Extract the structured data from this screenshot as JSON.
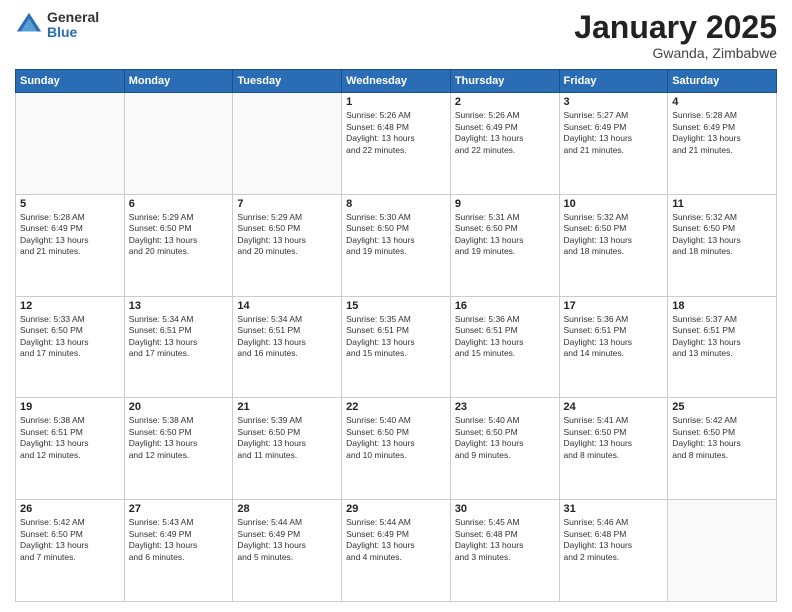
{
  "logo": {
    "general": "General",
    "blue": "Blue"
  },
  "title": {
    "month": "January 2025",
    "location": "Gwanda, Zimbabwe"
  },
  "days_of_week": [
    "Sunday",
    "Monday",
    "Tuesday",
    "Wednesday",
    "Thursday",
    "Friday",
    "Saturday"
  ],
  "weeks": [
    [
      {
        "day": "",
        "info": ""
      },
      {
        "day": "",
        "info": ""
      },
      {
        "day": "",
        "info": ""
      },
      {
        "day": "1",
        "info": "Sunrise: 5:26 AM\nSunset: 6:48 PM\nDaylight: 13 hours\nand 22 minutes."
      },
      {
        "day": "2",
        "info": "Sunrise: 5:26 AM\nSunset: 6:49 PM\nDaylight: 13 hours\nand 22 minutes."
      },
      {
        "day": "3",
        "info": "Sunrise: 5:27 AM\nSunset: 6:49 PM\nDaylight: 13 hours\nand 21 minutes."
      },
      {
        "day": "4",
        "info": "Sunrise: 5:28 AM\nSunset: 6:49 PM\nDaylight: 13 hours\nand 21 minutes."
      }
    ],
    [
      {
        "day": "5",
        "info": "Sunrise: 5:28 AM\nSunset: 6:49 PM\nDaylight: 13 hours\nand 21 minutes."
      },
      {
        "day": "6",
        "info": "Sunrise: 5:29 AM\nSunset: 6:50 PM\nDaylight: 13 hours\nand 20 minutes."
      },
      {
        "day": "7",
        "info": "Sunrise: 5:29 AM\nSunset: 6:50 PM\nDaylight: 13 hours\nand 20 minutes."
      },
      {
        "day": "8",
        "info": "Sunrise: 5:30 AM\nSunset: 6:50 PM\nDaylight: 13 hours\nand 19 minutes."
      },
      {
        "day": "9",
        "info": "Sunrise: 5:31 AM\nSunset: 6:50 PM\nDaylight: 13 hours\nand 19 minutes."
      },
      {
        "day": "10",
        "info": "Sunrise: 5:32 AM\nSunset: 6:50 PM\nDaylight: 13 hours\nand 18 minutes."
      },
      {
        "day": "11",
        "info": "Sunrise: 5:32 AM\nSunset: 6:50 PM\nDaylight: 13 hours\nand 18 minutes."
      }
    ],
    [
      {
        "day": "12",
        "info": "Sunrise: 5:33 AM\nSunset: 6:50 PM\nDaylight: 13 hours\nand 17 minutes."
      },
      {
        "day": "13",
        "info": "Sunrise: 5:34 AM\nSunset: 6:51 PM\nDaylight: 13 hours\nand 17 minutes."
      },
      {
        "day": "14",
        "info": "Sunrise: 5:34 AM\nSunset: 6:51 PM\nDaylight: 13 hours\nand 16 minutes."
      },
      {
        "day": "15",
        "info": "Sunrise: 5:35 AM\nSunset: 6:51 PM\nDaylight: 13 hours\nand 15 minutes."
      },
      {
        "day": "16",
        "info": "Sunrise: 5:36 AM\nSunset: 6:51 PM\nDaylight: 13 hours\nand 15 minutes."
      },
      {
        "day": "17",
        "info": "Sunrise: 5:36 AM\nSunset: 6:51 PM\nDaylight: 13 hours\nand 14 minutes."
      },
      {
        "day": "18",
        "info": "Sunrise: 5:37 AM\nSunset: 6:51 PM\nDaylight: 13 hours\nand 13 minutes."
      }
    ],
    [
      {
        "day": "19",
        "info": "Sunrise: 5:38 AM\nSunset: 6:51 PM\nDaylight: 13 hours\nand 12 minutes."
      },
      {
        "day": "20",
        "info": "Sunrise: 5:38 AM\nSunset: 6:50 PM\nDaylight: 13 hours\nand 12 minutes."
      },
      {
        "day": "21",
        "info": "Sunrise: 5:39 AM\nSunset: 6:50 PM\nDaylight: 13 hours\nand 11 minutes."
      },
      {
        "day": "22",
        "info": "Sunrise: 5:40 AM\nSunset: 6:50 PM\nDaylight: 13 hours\nand 10 minutes."
      },
      {
        "day": "23",
        "info": "Sunrise: 5:40 AM\nSunset: 6:50 PM\nDaylight: 13 hours\nand 9 minutes."
      },
      {
        "day": "24",
        "info": "Sunrise: 5:41 AM\nSunset: 6:50 PM\nDaylight: 13 hours\nand 8 minutes."
      },
      {
        "day": "25",
        "info": "Sunrise: 5:42 AM\nSunset: 6:50 PM\nDaylight: 13 hours\nand 8 minutes."
      }
    ],
    [
      {
        "day": "26",
        "info": "Sunrise: 5:42 AM\nSunset: 6:50 PM\nDaylight: 13 hours\nand 7 minutes."
      },
      {
        "day": "27",
        "info": "Sunrise: 5:43 AM\nSunset: 6:49 PM\nDaylight: 13 hours\nand 6 minutes."
      },
      {
        "day": "28",
        "info": "Sunrise: 5:44 AM\nSunset: 6:49 PM\nDaylight: 13 hours\nand 5 minutes."
      },
      {
        "day": "29",
        "info": "Sunrise: 5:44 AM\nSunset: 6:49 PM\nDaylight: 13 hours\nand 4 minutes."
      },
      {
        "day": "30",
        "info": "Sunrise: 5:45 AM\nSunset: 6:48 PM\nDaylight: 13 hours\nand 3 minutes."
      },
      {
        "day": "31",
        "info": "Sunrise: 5:46 AM\nSunset: 6:48 PM\nDaylight: 13 hours\nand 2 minutes."
      },
      {
        "day": "",
        "info": ""
      }
    ]
  ]
}
